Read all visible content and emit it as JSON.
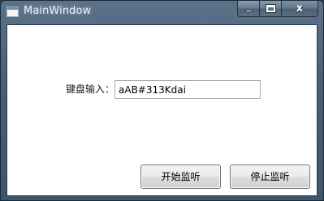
{
  "window": {
    "title": "MainWindow",
    "caption": {
      "minimize_icon": "minimize-icon",
      "maximize_icon": "maximize-icon",
      "close_glyph": "x"
    }
  },
  "form": {
    "keyboard_label": "键盘输入：",
    "keyboard_value": "aAB#313Kdai"
  },
  "buttons": {
    "start_label": "开始监听",
    "stop_label": "停止监听"
  },
  "colors": {
    "titlebar": "#47607a",
    "client_background": "#ffffff",
    "button_border": "#707070"
  }
}
